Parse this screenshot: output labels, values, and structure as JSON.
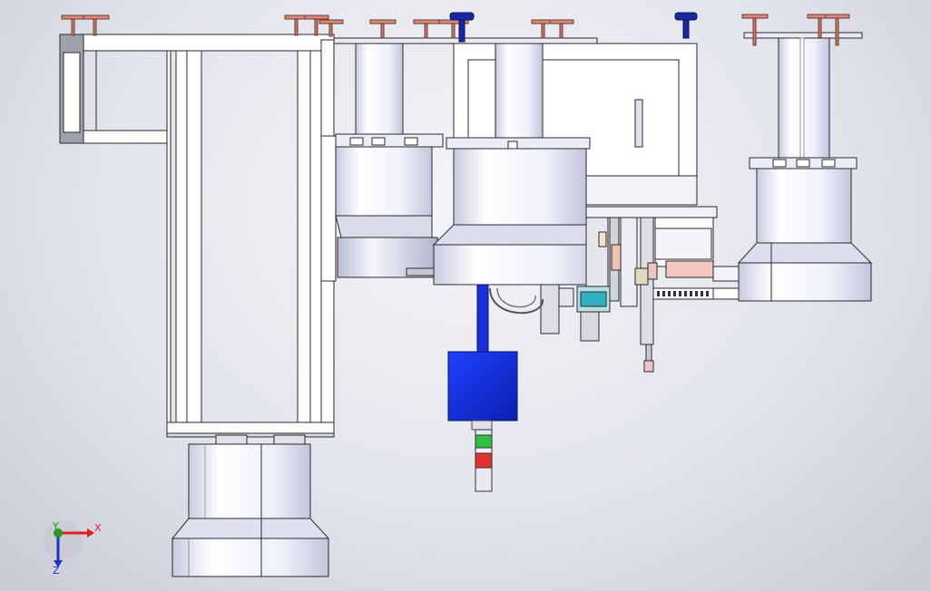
{
  "triad": {
    "x_label": "X",
    "y_label": "Y",
    "z_label": "Z",
    "x_color": "#e02020",
    "y_color": "#20a020",
    "z_color": "#2030c0"
  },
  "colors": {
    "frame": "#ffffff",
    "edge": "#2a2a2a",
    "motor_blue": "#1030e0",
    "tower_green": "#30c040",
    "tower_red": "#e03030",
    "foot_pad": "#d98a7a"
  }
}
